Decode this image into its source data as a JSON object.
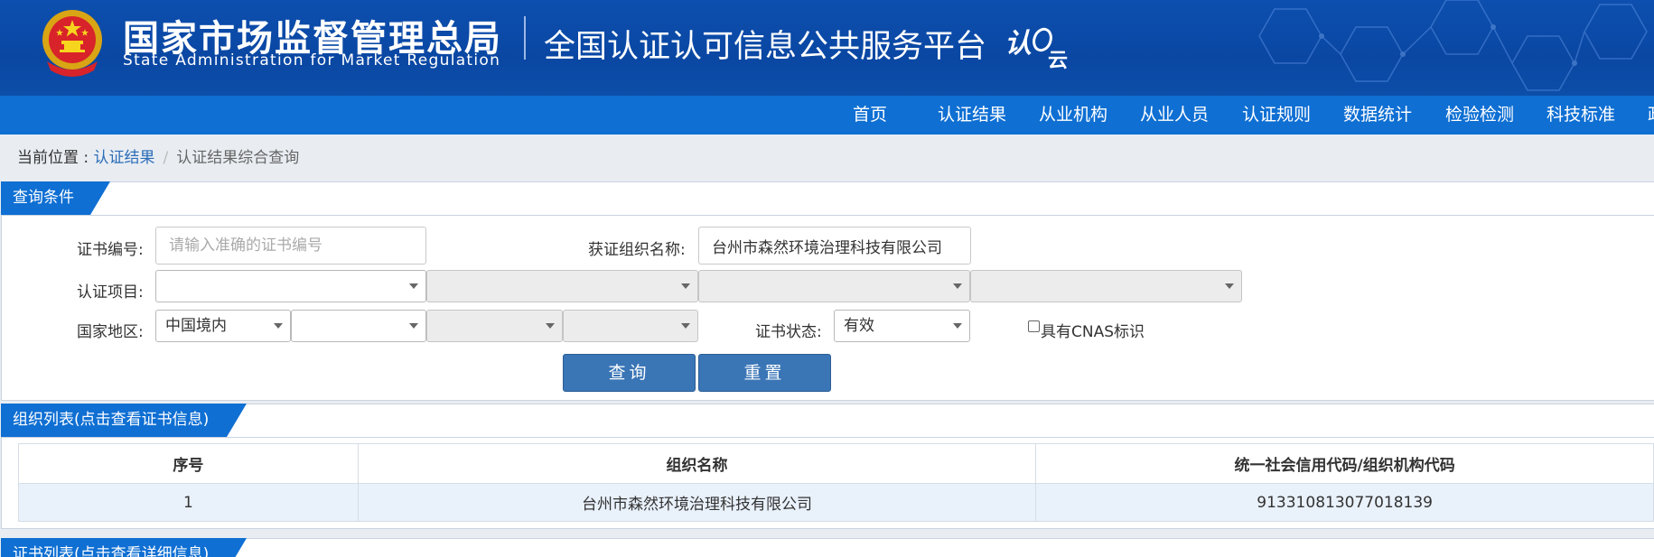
{
  "header": {
    "org_cn": "国家市场监督管理总局",
    "org_en": "State Administration for Market Regulation",
    "platform": "全国认证认可信息公共服务平台",
    "logo_text": "认证云",
    "emblem_icon": "national-emblem-icon"
  },
  "nav": {
    "items": [
      "首页",
      "认证结果",
      "从业机构",
      "从业人员",
      "认证规则",
      "数据统计",
      "检验检测",
      "科技标准",
      "政"
    ]
  },
  "breadcrumb": {
    "prefix": "当前位置 : ",
    "link": "认证结果",
    "separator": "/",
    "current": "认证结果综合查询"
  },
  "query_panel": {
    "tab": "查询条件",
    "cert_no_label": "证书编号:",
    "cert_no_placeholder": "请输入准确的证书编号",
    "cert_no_value": "",
    "org_name_label": "获证组织名称:",
    "org_name_value": "台州市森然环境治理科技有限公司",
    "project_label": "认证项目:",
    "project_selects": [
      "",
      "",
      "",
      ""
    ],
    "region_label": "国家地区:",
    "region_selects": [
      "中国境内",
      "",
      "",
      ""
    ],
    "status_label": "证书状态:",
    "status_value": "有效",
    "cnas_label": "具有CNAS标识",
    "search_button": "查询",
    "reset_button": "重置"
  },
  "org_panel": {
    "tab": "组织列表(点击查看证书信息)",
    "columns": [
      "序号",
      "组织名称",
      "统一社会信用代码/组织机构代码"
    ],
    "rows": [
      [
        "1",
        "台州市森然环境治理科技有限公司",
        "913310813077018139"
      ]
    ]
  },
  "cert_panel": {
    "tab": "证书列表(点击查看详细信息)"
  },
  "colors": {
    "header_bg": "#0a47a3",
    "nav_bg": "#0f6fd3",
    "button_bg": "#3a75b6",
    "row_bg": "#e9f1fb",
    "link": "#2c6db8"
  }
}
